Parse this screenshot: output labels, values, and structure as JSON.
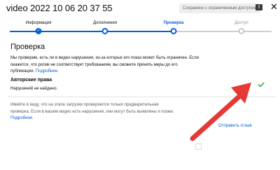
{
  "header": {
    "title": "video 2022 10 06 20 37 55",
    "saved_status": "Сохранено с ограниченным доступом",
    "feedback_icon_glyph": "!",
    "close_icon_glyph": "✕"
  },
  "stepper": {
    "steps": [
      {
        "label": "Информация",
        "state": "done"
      },
      {
        "label": "Дополнения",
        "state": "done"
      },
      {
        "label": "Проверка",
        "state": "current"
      },
      {
        "label": "Доступ",
        "state": "upcoming"
      }
    ],
    "done_glyph": "✓"
  },
  "main": {
    "title": "Проверка",
    "description": "Мы проверим, есть ли в видео нарушения, из-за которых его показ может быть ограничен. Если окажется, что ролик не соответствует требованиям, вы сможете принять меры до его публикации.",
    "description_link": "Подробнее",
    "copyright": {
      "title": "Авторские права",
      "status": "Нарушений не найдено."
    },
    "note": "Имейте в виду, что на этапе загрузки проверяются только предварительная проверка. Если в вашем видео есть нарушения, они могут быть выявлены и позже.",
    "note_link": "Подробнее",
    "feedback_link": "Отправить отзыв"
  },
  "colors": {
    "accent": "#065fd4",
    "success_check": "#2ba640",
    "annotation_arrow": "#e53935"
  },
  "icons": {
    "check": "check-icon",
    "feedback": "feedback-icon",
    "close": "close-icon"
  }
}
